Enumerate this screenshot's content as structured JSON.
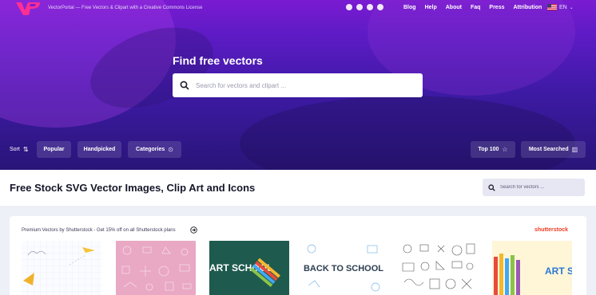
{
  "header": {
    "logo_icon": "vp-logo",
    "tagline": "VectorPortal — Free Vectors & Clipart with a Creative Commons License",
    "social_icons": [
      "twitter-icon",
      "facebook-icon",
      "pinterest-icon",
      "dribbble-icon"
    ],
    "nav": [
      "Blog",
      "Help",
      "About",
      "Faq",
      "Press",
      "Attribution"
    ],
    "language": {
      "flag_icon": "us-flag-icon",
      "code": "EN"
    }
  },
  "hero": {
    "title": "Find free vectors",
    "search_placeholder": "Search for vectors and clipart ..."
  },
  "filters": {
    "sort_label": "Sort",
    "popular": "Popular",
    "handpicked": "Handpicked",
    "categories": "Categories",
    "top100": "Top 100",
    "most_searched": "Most Searched"
  },
  "page": {
    "title": "Free Stock SVG Vector Images, Clip Art and Icons",
    "search_placeholder": "Search for vectors ..."
  },
  "premium": {
    "text": "Premium Vectors by Shutterstock - Get 15% off on all Shutterstock plans",
    "brand": "shutterstock",
    "thumbs": [
      {
        "art": "doodle-planes"
      },
      {
        "art": "pink-school-pattern"
      },
      {
        "art": "art-school-chalkboard",
        "title": "ART SCHOOL"
      },
      {
        "art": "back-to-school-lettering",
        "title": "BACK TO SCHOOL"
      },
      {
        "art": "school-doodles-pattern"
      },
      {
        "art": "art-school-pencils",
        "title": "ART SCHOOL"
      }
    ]
  },
  "colors": {
    "hero_top": "#7a1bd2",
    "hero_bottom": "#291578",
    "logo": "#ff2f93",
    "brand_red": "#ef3c23"
  }
}
